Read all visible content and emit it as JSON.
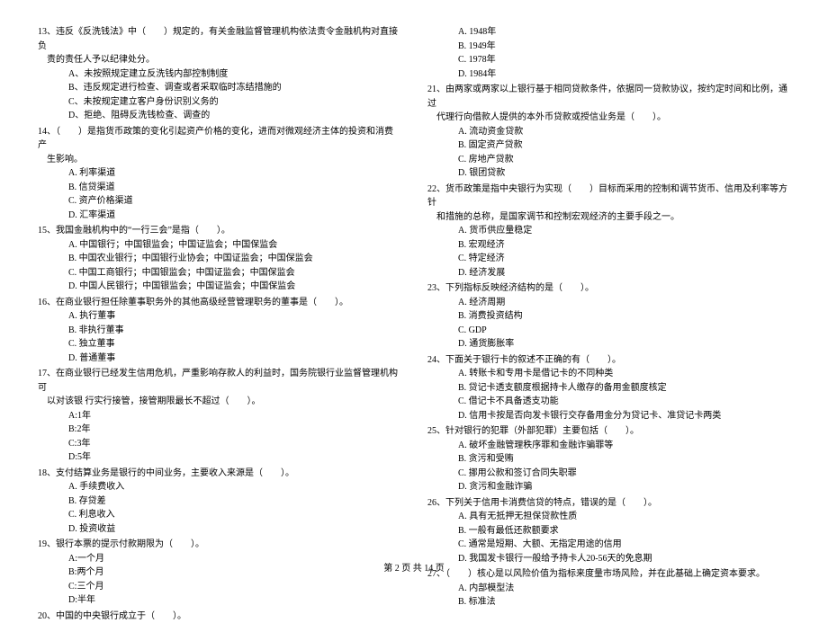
{
  "footer": "第 2 页 共 14 页",
  "left": {
    "q13": {
      "stem": "13、违反《反洗钱法》中（　　）规定的，有关金融监督管理机构依法责令金融机构对直接负",
      "stem2": "责的责任人予以纪律处分。",
      "A": "A、未按照规定建立反洗钱内部控制制度",
      "B": "B、违反规定进行检查、调查或者采取临时冻结措施的",
      "C": "C、未按规定建立客户身份识别义务的",
      "D": "D、拒绝、阻碍反洗钱检查、调查的"
    },
    "q14": {
      "stem": "14、（　　）是指货币政策的变化引起资产价格的变化，进而对微观经济主体的投资和消费产",
      "stem2": "生影响。",
      "A": "A. 利率渠道",
      "B": "B. 信贷渠道",
      "C": "C. 资产价格渠道",
      "D": "D. 汇率渠道"
    },
    "q15": {
      "stem": "15、我国金融机构中的“一行三会”是指（　　）。",
      "A": "A. 中国银行；中国银监会；中国证监会；中国保监会",
      "B": "B. 中国农业银行；中国银行业协会；中国证监会；中国保监会",
      "C": "C. 中国工商银行；中国银监会；中国证监会；中国保监会",
      "D": "D. 中国人民银行；中国银监会；中国证监会；中国保监会"
    },
    "q16": {
      "stem": "16、在商业银行担任除董事职务外的其他高级经营管理职务的董事是（　　）。",
      "A": "A. 执行董事",
      "B": "B. 非执行董事",
      "C": "C. 独立董事",
      "D": "D. 普通董事"
    },
    "q17": {
      "stem": "17、在商业银行已经发生信用危机，严重影响存款人的利益时，国务院银行业监督管理机构可",
      "stem2": "以对该银 行实行接管，接管期限最长不超过（　　）。",
      "A": "A:1年",
      "B": "B:2年",
      "C": "C:3年",
      "D": "D:5年"
    },
    "q18": {
      "stem": "18、支付结算业务是银行的中间业务，主要收入来源是（　　）。",
      "A": "A. 手续费收入",
      "B": "B. 存贷差",
      "C": "C. 利息收入",
      "D": "D. 投资收益"
    },
    "q19": {
      "stem": "19、银行本票的提示付款期限为（　　）。",
      "A": "A:一个月",
      "B": "B:两个月",
      "C": "C:三个月",
      "D": "D:半年"
    },
    "q20": {
      "stem": "20、中国的中央银行成立于（　　）。"
    }
  },
  "right": {
    "q20opts": {
      "A": "A. 1948年",
      "B": "B. 1949年",
      "C": "C. 1978年",
      "D": "D. 1984年"
    },
    "q21": {
      "stem": "21、由两家或两家以上银行基于相同贷款条件，依据同一贷款协议，按约定时间和比例，通过",
      "stem2": "代理行向借款人提供的本外币贷款或授信业务是（　　）。",
      "A": "A. 流动资金贷款",
      "B": "B. 固定资产贷款",
      "C": "C. 房地产贷款",
      "D": "D. 银团贷款"
    },
    "q22": {
      "stem": "22、货币政策是指中央银行为实现（　　）目标而采用的控制和调节货币、信用及利率等方针",
      "stem2": "和措施的总称，是国家调节和控制宏观经济的主要手段之一。",
      "A": "A. 货币供应量稳定",
      "B": "B. 宏观经济",
      "C": "C. 特定经济",
      "D": "D. 经济发展"
    },
    "q23": {
      "stem": "23、下列指标反映经济结构的是（　　）。",
      "A": "A. 经济周期",
      "B": "B. 消费投资结构",
      "C": "C. GDP",
      "D": "D. 通货膨胀率"
    },
    "q24": {
      "stem": "24、下面关于银行卡的叙述不正确的有（　　）。",
      "A": "A. 转账卡和专用卡是借记卡的不同种类",
      "B": "B. 贷记卡透支额度根据持卡人缴存的备用金额度核定",
      "C": "C. 借记卡不具备透支功能",
      "D": "D. 信用卡按是否向发卡银行交存备用金分为贷记卡、准贷记卡两类"
    },
    "q25": {
      "stem": "25、针对银行的犯罪（外部犯罪）主要包括（　　）。",
      "A": "A. 破坏金融管理秩序罪和金融诈骗罪等",
      "B": "B. 贪污和受贿",
      "C": "C. 挪用公款和签订合同失职罪",
      "D": "D. 贪污和金融诈骗"
    },
    "q26": {
      "stem": "26、下列关于信用卡消费信贷的特点，错误的是（　　）。",
      "A": "A. 具有无抵押无担保贷款性质",
      "B": "B. 一般有最低还款额要求",
      "C": "C. 通常是短期、大额、无指定用途的信用",
      "D": "D. 我国发卡银行一般给予持卡人20-56天的免息期"
    },
    "q27": {
      "stem": "27、（　　）核心是以风险价值为指标来度量市场风险，并在此基础上确定资本要求。",
      "A": "A. 内部模型法",
      "B": "B. 标准法"
    }
  }
}
